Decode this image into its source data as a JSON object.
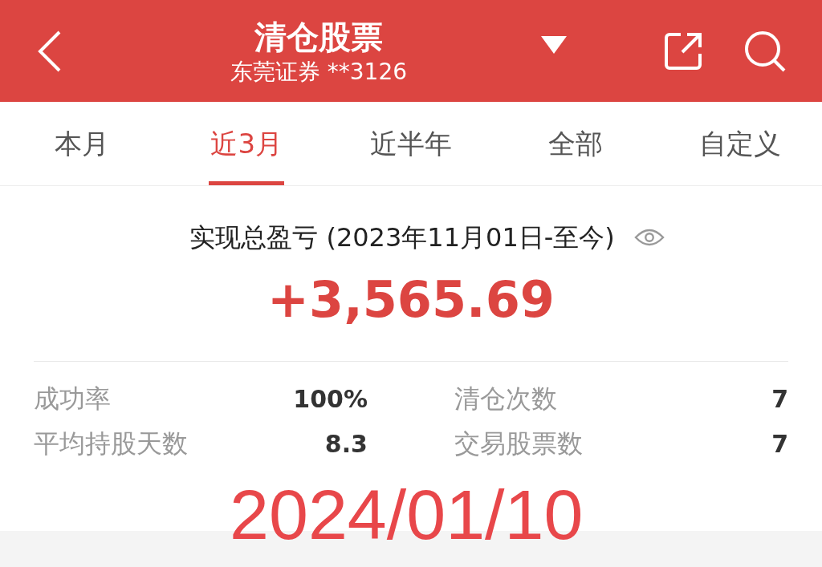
{
  "header": {
    "title": "清仓股票",
    "subtitle": "东莞证券 **3126"
  },
  "tabs": [
    {
      "label": "本月",
      "selected": false
    },
    {
      "label": "近3月",
      "selected": true
    },
    {
      "label": "近半年",
      "selected": false
    },
    {
      "label": "全部",
      "selected": false
    },
    {
      "label": "自定义",
      "selected": false
    }
  ],
  "summary": {
    "label": "实现总盈亏 (2023年11月01日-至今)",
    "amount": "+3,565.69"
  },
  "stats": [
    {
      "label": "成功率",
      "value": "100%"
    },
    {
      "label": "清仓次数",
      "value": "7"
    },
    {
      "label": "平均持股天数",
      "value": "8.3"
    },
    {
      "label": "交易股票数",
      "value": "7"
    }
  ],
  "date_overlay": "2024/01/10"
}
